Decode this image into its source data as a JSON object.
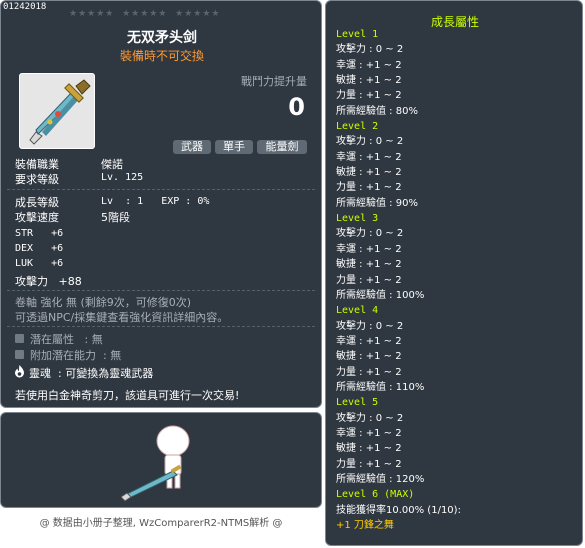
{
  "item": {
    "code": "01242018",
    "stars": "★★★★★  ★★★★★  ★★★★★",
    "name": "无双矛头剑",
    "trade_status": "裝備時不可交換",
    "power_label": "戰鬥力提升量",
    "power_value": "0",
    "tags": [
      "武器",
      "單手",
      "能量劍"
    ]
  },
  "requirements": [
    {
      "label": "裝備職業",
      "value": "傑諾"
    },
    {
      "label": "要求等級",
      "value": "Lv. 125"
    }
  ],
  "stats": {
    "growth_level_label": "成長等級",
    "growth_level_value": "Lv  : 1   EXP : 0%",
    "attack_speed_label": "攻擊速度",
    "attack_speed_value": "5階段",
    "str": "STR   +6",
    "dex": "DEX   +6",
    "luk": "LUK   +6",
    "attack": "攻擊力   +88"
  },
  "upgrade_info": {
    "line1": "卷軸 強化 無 (剩餘9次，可修復0次)",
    "line2": "可透過NPC/採集鍵查看強化資訊詳細內容。"
  },
  "potential": {
    "potential_line": "潛在屬性   : 無",
    "additional_line": "附加潛在能力  : 無"
  },
  "soul_line": "靈魂  : 可變換為靈魂武器",
  "scissors_line": "若使用白金神奇剪刀，該道具可進行一次交易!",
  "credits": "@ 数据由小册子整理, WzComparerR2-NTMS解析 @",
  "growth": {
    "title": "成長屬性",
    "levels": [
      {
        "header": "Level 1",
        "lines": [
          "攻擊力 : 0 ~ 2",
          "幸運 : +1 ~ 2",
          "敏捷 : +1 ~ 2",
          "力量 : +1 ~ 2",
          "所需經驗值 : 80%"
        ]
      },
      {
        "header": "Level 2",
        "lines": [
          "攻擊力 : 0 ~ 2",
          "幸運 : +1 ~ 2",
          "敏捷 : +1 ~ 2",
          "力量 : +1 ~ 2",
          "所需經驗值 : 90%"
        ]
      },
      {
        "header": "Level 3",
        "lines": [
          "攻擊力 : 0 ~ 2",
          "幸運 : +1 ~ 2",
          "敏捷 : +1 ~ 2",
          "力量 : +1 ~ 2",
          "所需經驗值 : 100%"
        ]
      },
      {
        "header": "Level 4",
        "lines": [
          "攻擊力 : 0 ~ 2",
          "幸運 : +1 ~ 2",
          "敏捷 : +1 ~ 2",
          "力量 : +1 ~ 2",
          "所需經驗值 : 110%"
        ]
      },
      {
        "header": "Level 5",
        "lines": [
          "攻擊力 : 0 ~ 2",
          "幸運 : +1 ~ 2",
          "敏捷 : +1 ~ 2",
          "力量 : +1 ~ 2",
          "所需經驗值 : 120%"
        ]
      }
    ],
    "max_header": "Level 6 (MAX)",
    "max_line": "技能獲得率10.00% (1/10):",
    "skill_bonus": "+1 刀鋒之舞"
  }
}
